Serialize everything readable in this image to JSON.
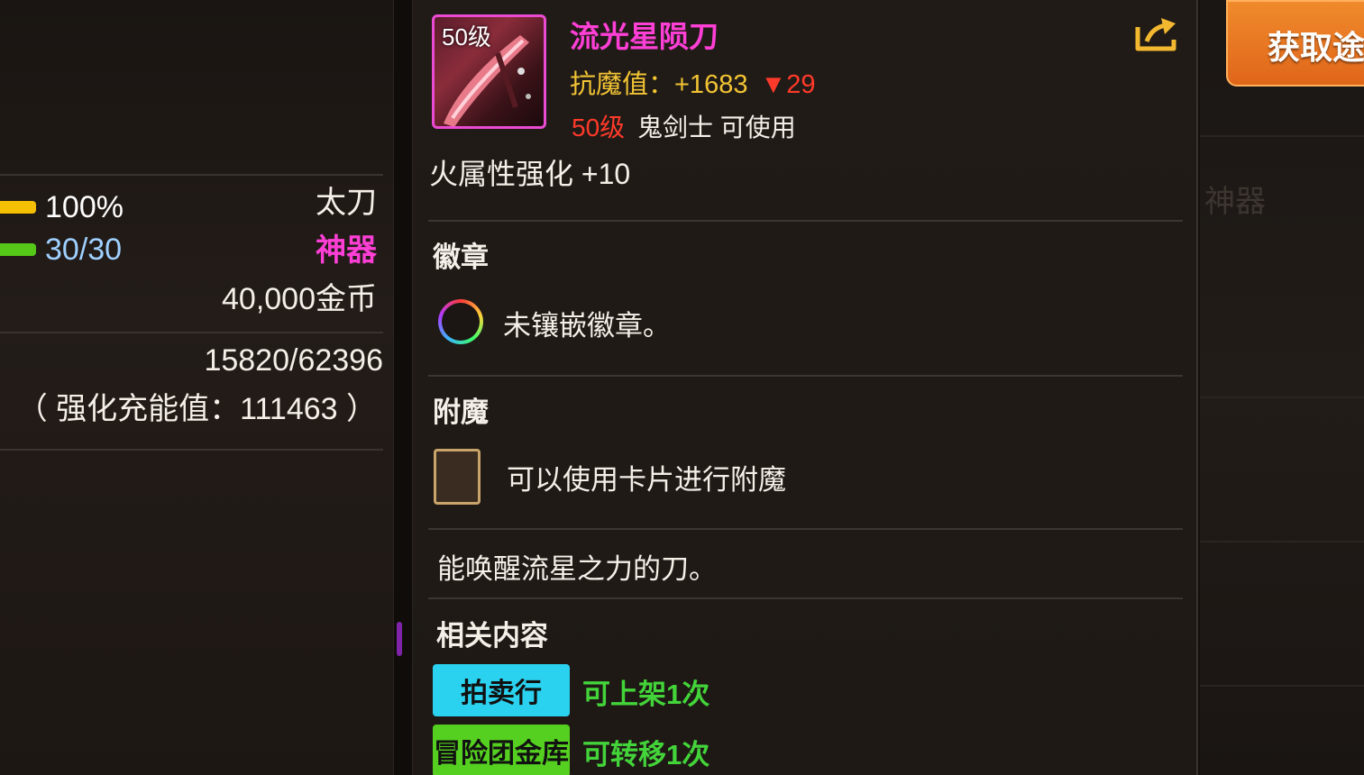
{
  "left_panel": {
    "durability_percent": "100%",
    "durability_fill": 1.0,
    "durability_color": "#f5c000",
    "weapon_type": "太刀",
    "uses": "30/30",
    "uses_fill": 1.0,
    "uses_color": "#55c818",
    "rarity": "神器",
    "rarity_color": "#ff3fd6",
    "price": "40,000金币",
    "exp": "15820/62396",
    "reinforce_charge": "（ 强化充能值：111463 ）"
  },
  "item": {
    "level_tag": "50级",
    "name": "流光星陨刀",
    "name_color": "#ff3fd6",
    "stat_label": "抗魔值：+1683",
    "stat_change": "▼29",
    "req_level": "50级",
    "req_class": "鬼剑士 可使用",
    "fire_enhance": "火属性强化 +10",
    "badge_title": "徽章",
    "badge_text": "未镶嵌徽章。",
    "enchant_title": "附魔",
    "enchant_text": "可以使用卡片进行附魔",
    "description": "能唤醒流星之力的刀。",
    "related_title": "相关内容",
    "related": [
      {
        "label": "拍卖行",
        "status": "可上架1次",
        "color": "#2ad2f0"
      },
      {
        "label": "冒险团金库",
        "status": "可转移1次",
        "color": "#55d020"
      }
    ]
  },
  "actions": {
    "share_icon": "share-icon",
    "get_button": "获取途"
  },
  "right_panel": {
    "faded_text": "神器"
  }
}
